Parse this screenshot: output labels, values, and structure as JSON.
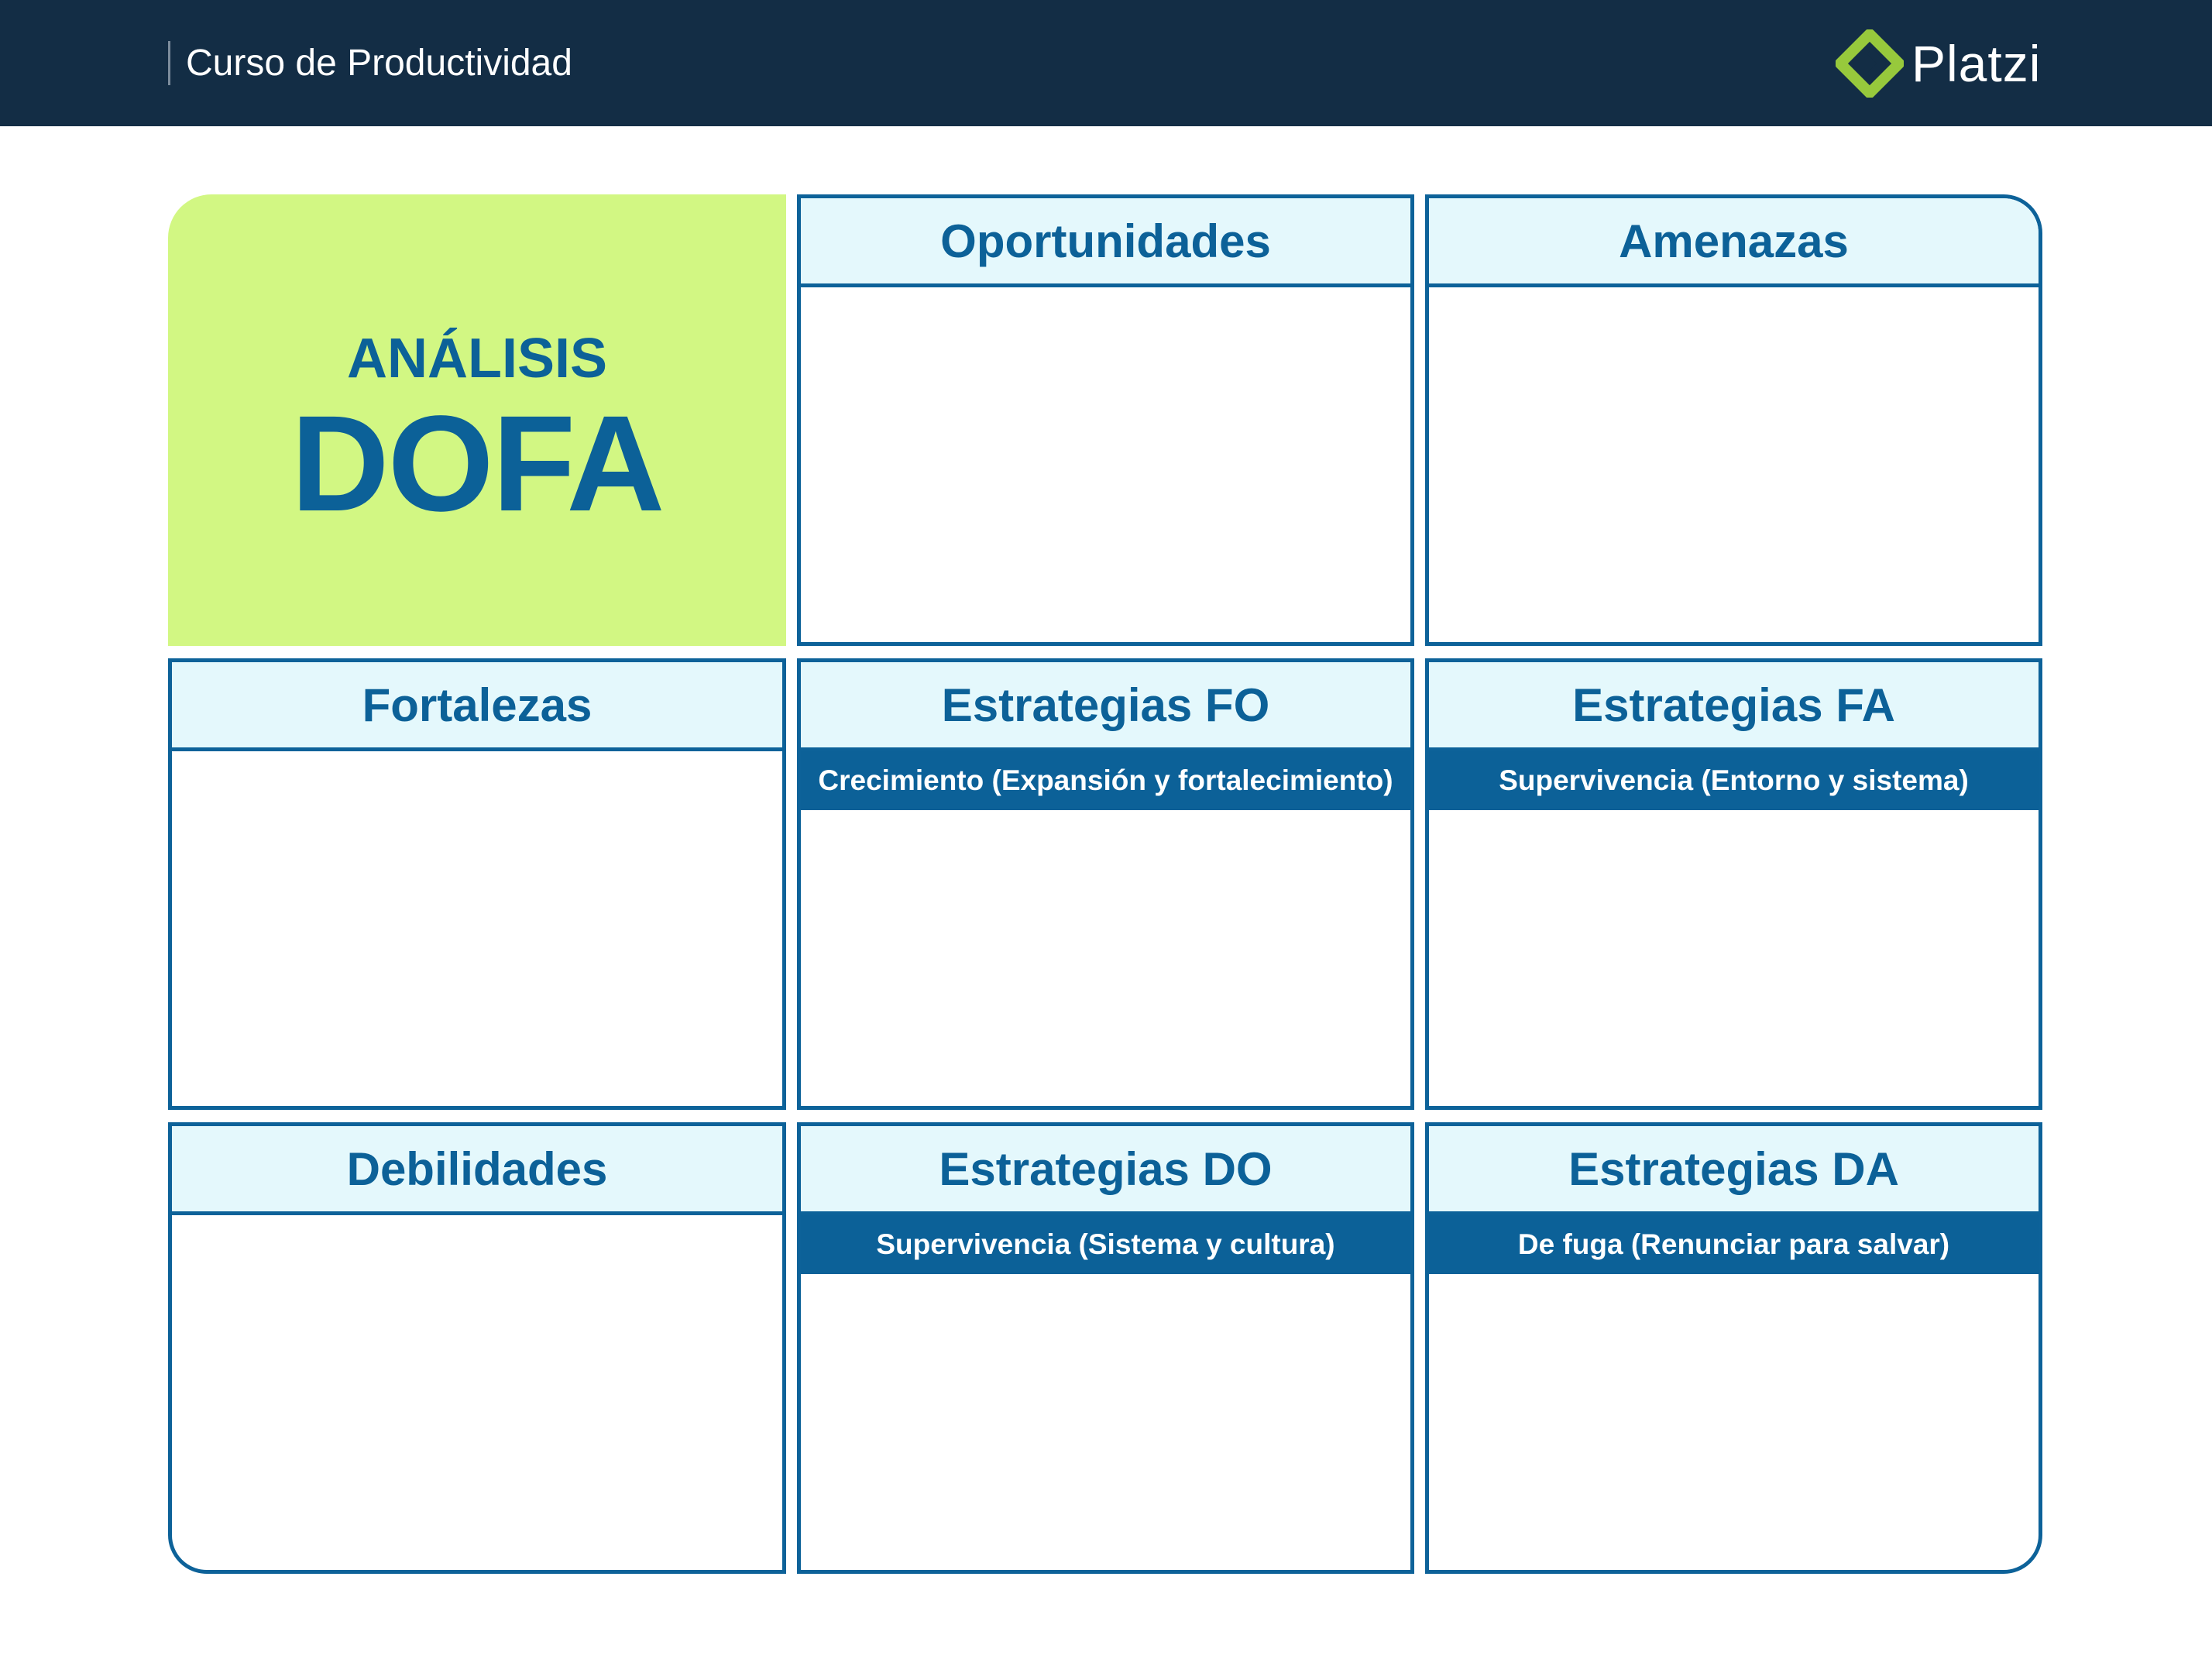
{
  "header": {
    "course_title": "Curso de Productividad",
    "logo_text": "Platzi",
    "logo_icon": "platzi-logo-icon",
    "background_color": "#132d45",
    "logo_color": "#97c93c"
  },
  "title": {
    "small": "ANÁLISIS",
    "big": "DOFA",
    "background_color": "#d2f783"
  },
  "grid": {
    "row1": [
      {
        "heading": "Oportunidades"
      },
      {
        "heading": "Amenazas"
      }
    ],
    "row2": [
      {
        "heading": "Fortalezas"
      },
      {
        "heading": "Estrategias FO",
        "subheading": "Crecimiento (Expansión y fortalecimiento)"
      },
      {
        "heading": "Estrategias FA",
        "subheading": "Supervivencia (Entorno y sistema)"
      }
    ],
    "row3": [
      {
        "heading": "Debilidades"
      },
      {
        "heading": "Estrategias DO",
        "subheading": "Supervivencia (Sistema y cultura)"
      },
      {
        "heading": "Estrategias DA",
        "subheading": "De fuga (Renunciar para salvar)"
      }
    ]
  },
  "colors": {
    "border": "#0d6299",
    "heading_bg": "#e4f8fc",
    "subheading_bg": "#0c6198"
  }
}
